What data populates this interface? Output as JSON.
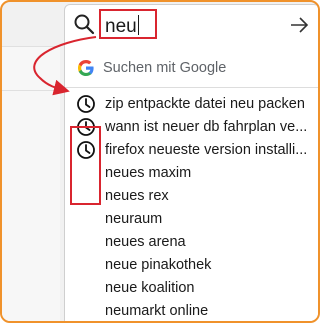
{
  "search": {
    "query": "neu"
  },
  "engine": {
    "label": "Suchen mit Google",
    "icon": "google-g-icon"
  },
  "history": [
    {
      "text": "zip entpackte datei neu packen",
      "icon": "history-clock-icon"
    },
    {
      "text": "wann ist neuer db fahrplan ve...",
      "icon": "history-clock-icon"
    },
    {
      "text": "firefox neueste version installi...",
      "icon": "history-clock-icon"
    }
  ],
  "suggestions": [
    {
      "text": "neues maxim"
    },
    {
      "text": "neues rex"
    },
    {
      "text": "neuraum"
    },
    {
      "text": "neues arena"
    },
    {
      "text": "neue pinakothek"
    },
    {
      "text": "neue koalition"
    },
    {
      "text": "neumarkt online"
    }
  ],
  "colors": {
    "highlight": "#d9252f",
    "frame": "#f0922b"
  }
}
